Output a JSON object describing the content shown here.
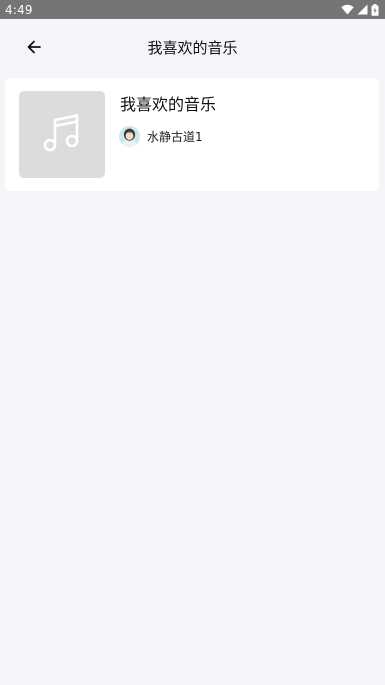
{
  "status_bar": {
    "time": "4:49",
    "icons": [
      "wifi-icon",
      "cellular-signal-icon",
      "battery-charging-icon"
    ]
  },
  "header": {
    "title": "我喜欢的音乐",
    "back_icon": "arrow-left-icon"
  },
  "playlist": {
    "name": "我喜欢的音乐",
    "cover_icon": "music-note-icon",
    "creator": {
      "name": "水静古道1",
      "avatar_icon": "user-avatar-icon"
    }
  },
  "colors": {
    "status_bar_bg": "#757575",
    "page_bg": "#f4f5f9",
    "card_bg": "#ffffff",
    "cover_bg": "#dcdcdc"
  }
}
